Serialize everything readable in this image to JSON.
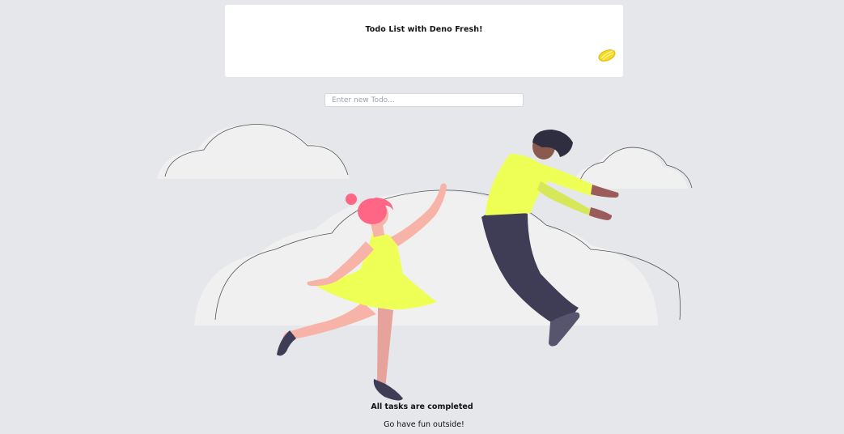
{
  "app": {
    "title": "Todo List with Deno Fresh!",
    "logo_icon": "lemon-icon"
  },
  "new_todo": {
    "placeholder": "Enter new Todo...",
    "value": ""
  },
  "empty_state": {
    "illustration_icon": "dancing-couple-illustration",
    "title": "All tasks are completed",
    "subtitle": "Go have fun outside!"
  },
  "colors": {
    "background": "#e5e7eb",
    "accent_yellow": "#eeff55",
    "card": "#ffffff"
  }
}
